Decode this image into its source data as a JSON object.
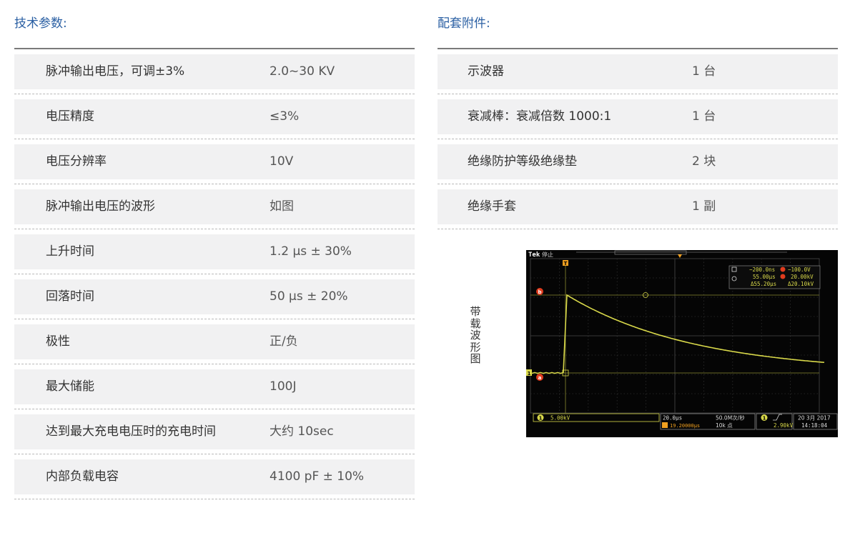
{
  "specs": {
    "title": "技术参数:",
    "rows": [
      {
        "label": "脉冲输出电压，可调±3%",
        "value": "2.0~30 KV"
      },
      {
        "label": "电压精度",
        "value": "≤3%"
      },
      {
        "label": "电压分辨率",
        "value": "10V"
      },
      {
        "label": "脉冲输出电压的波形",
        "value": " 如图"
      },
      {
        "label": "上升时间",
        "value": "1.2 µs  ±  30%"
      },
      {
        "label": "回落时间",
        "value": "50 µs  ±  20%"
      },
      {
        "label": "极性",
        "value": "正/负"
      },
      {
        "label": "最大储能",
        "value": "100J"
      },
      {
        "label": "达到最大充电电压时的充电时间",
        "value": "大约 10sec"
      },
      {
        "label": "内部负载电容",
        "value": "4100 pF  ±  10%"
      }
    ]
  },
  "accessories": {
    "title": "配套附件:",
    "rows": [
      {
        "label": "示波器",
        "value": "1 台"
      },
      {
        "label": "衰减棒：衰减倍数 1000:1",
        "value": "1 台"
      },
      {
        "label": "绝缘防护等级绝缘垫",
        "value": "2 块"
      },
      {
        "label": "绝缘手套",
        "value": "1 副"
      }
    ]
  },
  "scope": {
    "caption": [
      "带",
      "载",
      "波",
      "形",
      "图"
    ],
    "brand": "Tek",
    "state": "停止",
    "marker_t": "T",
    "marker_a": "a",
    "marker_b": "b",
    "ch1_marker": "1",
    "cursor": {
      "r1_time": "−200.0ns",
      "r1_volt": "−100.0V",
      "r2_time": "55.00µs",
      "r2_volt": "20.00kV",
      "delta_time": "Δ55.20µs",
      "delta_volt": "Δ20.10kV"
    },
    "status": {
      "ch1_scale": "5.00kV",
      "timebase": "20.0µs",
      "sample_rate": "50.0M次/秒",
      "trigger_pos": "19.20000µs",
      "record_length": "10k 点",
      "trigger_level": "2.90kV",
      "date": "20 3月 2017",
      "time": "14:18:04"
    },
    "colors": {
      "trace": "#d9d94a",
      "red": "#e03c1e",
      "orange": "#f0a020",
      "screen": "#050505"
    }
  }
}
